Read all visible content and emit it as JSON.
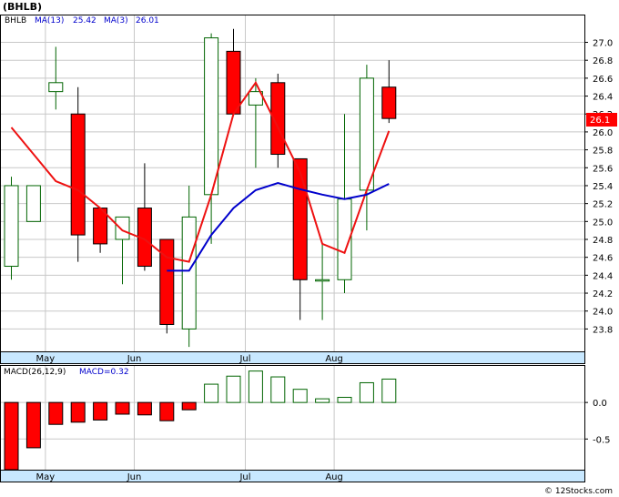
{
  "chart_data": [
    {
      "type": "candlestick",
      "title": "(BHLB)",
      "legend": {
        "symbol": "BHLB",
        "ma_long_label": "MA(13)",
        "ma_long_value": "25.42",
        "ma_short_label": "MA(3)",
        "ma_short_value": "26.01"
      },
      "last_price_label": "26.1",
      "ylim": [
        23.55,
        27.3
      ],
      "y_ticks": [
        "27.0",
        "26.8",
        "26.6",
        "26.4",
        "26.2",
        "26.0",
        "25.8",
        "25.6",
        "25.4",
        "25.2",
        "25.0",
        "24.8",
        "24.6",
        "24.4",
        "24.2",
        "24.0",
        "23.8"
      ],
      "x_ticks": [
        {
          "label": "May",
          "index": 1
        },
        {
          "label": "Jun",
          "index": 5
        },
        {
          "label": "Jul",
          "index": 10
        },
        {
          "label": "Aug",
          "index": 14
        }
      ],
      "candles": [
        {
          "o": 24.5,
          "h": 25.5,
          "l": 24.35,
          "c": 25.4
        },
        {
          "o": 25.0,
          "h": 25.35,
          "l": 25.1,
          "c": 25.4
        },
        {
          "o": 26.45,
          "h": 26.95,
          "l": 26.25,
          "c": 26.55
        },
        {
          "o": 26.2,
          "h": 26.5,
          "l": 24.55,
          "c": 24.85
        },
        {
          "o": 25.15,
          "h": 25.15,
          "l": 24.65,
          "c": 24.75
        },
        {
          "o": 24.8,
          "h": 25.05,
          "l": 24.3,
          "c": 25.05
        },
        {
          "o": 25.15,
          "h": 25.65,
          "l": 24.45,
          "c": 24.5
        },
        {
          "o": 24.8,
          "h": 24.8,
          "l": 23.75,
          "c": 23.85
        },
        {
          "o": 23.8,
          "h": 25.4,
          "l": 23.6,
          "c": 25.05
        },
        {
          "o": 25.3,
          "h": 27.1,
          "l": 24.75,
          "c": 27.05
        },
        {
          "o": 26.9,
          "h": 27.15,
          "l": 26.2,
          "c": 26.2
        },
        {
          "o": 26.3,
          "h": 26.6,
          "l": 25.6,
          "c": 26.45
        },
        {
          "o": 26.55,
          "h": 26.65,
          "l": 25.6,
          "c": 25.75
        },
        {
          "o": 25.7,
          "h": 25.7,
          "l": 23.9,
          "c": 24.35
        },
        {
          "o": 24.35,
          "h": 24.75,
          "l": 23.9,
          "c": 24.35
        },
        {
          "o": 24.35,
          "h": 26.2,
          "l": 24.2,
          "c": 25.25
        },
        {
          "o": 25.35,
          "h": 26.75,
          "l": 24.9,
          "c": 26.6
        },
        {
          "o": 26.5,
          "h": 26.8,
          "l": 26.1,
          "c": 26.15
        }
      ],
      "ma13": [
        null,
        null,
        null,
        null,
        null,
        null,
        null,
        24.45,
        24.45,
        24.85,
        25.15,
        25.35,
        25.43,
        25.36,
        25.3,
        25.25,
        25.3,
        25.42
      ],
      "ma3": [
        26.05,
        25.75,
        25.45,
        25.35,
        25.15,
        24.9,
        24.8,
        24.6,
        24.55,
        25.3,
        26.2,
        26.55,
        26.05,
        25.55,
        24.75,
        24.65,
        25.35,
        26.01
      ],
      "colors": {
        "up": "#ffffff",
        "up_edge": "#006400",
        "down": "#ff0000",
        "down_edge": "#000000",
        "ma13": "#0000cc",
        "ma3": "#ee1111",
        "price_tag": "#ff0000"
      }
    },
    {
      "type": "bar",
      "title": "MACD",
      "legend": {
        "label": "MACD(26,12,9)",
        "value_label": "MACD=0.32"
      },
      "ylim": [
        -0.92,
        0.5
      ],
      "y_ticks": [
        "0.0",
        "-0.5"
      ],
      "values": [
        -0.95,
        -0.62,
        -0.3,
        -0.27,
        -0.24,
        -0.16,
        -0.17,
        -0.25,
        -0.1,
        0.25,
        0.36,
        0.43,
        0.35,
        0.18,
        0.05,
        0.07,
        0.27,
        0.32
      ],
      "colors": {
        "pos_edge": "#006400",
        "neg_fill": "#ff0000"
      }
    }
  ],
  "watermark": "© 12Stocks.com"
}
